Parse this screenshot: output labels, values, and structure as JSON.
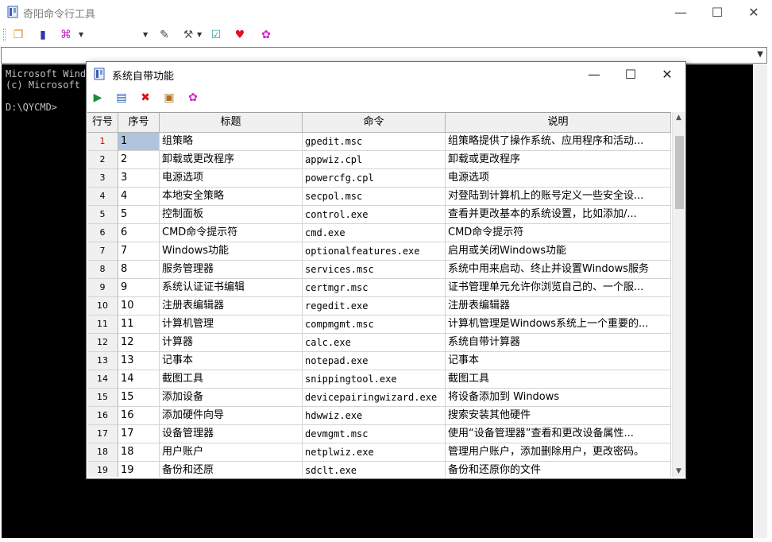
{
  "main_window": {
    "title": "奇阳命令行工具",
    "controls": {
      "minimize": "—",
      "maximize": "☐",
      "close": "✕"
    }
  },
  "console": {
    "lines": [
      "Microsoft Windo",
      "(c) Microsoft C",
      "",
      "D:\\QYCMD>"
    ]
  },
  "dialog": {
    "title": "系统自带功能",
    "controls": {
      "minimize": "—",
      "maximize": "☐",
      "close": "✕"
    },
    "toolbar": [
      {
        "name": "run-icon",
        "glyph": "▶",
        "color": "#1e8c3a"
      },
      {
        "name": "document-icon",
        "glyph": "▤",
        "color": "#1e5bb8"
      },
      {
        "name": "delete-icon",
        "glyph": "✖",
        "color": "#e01010"
      },
      {
        "name": "save-icon",
        "glyph": "▣",
        "color": "#b07020"
      },
      {
        "name": "settings-icon",
        "glyph": "✿",
        "color": "#d020d0"
      }
    ],
    "table": {
      "headers": [
        "行号",
        "序号",
        "标题",
        "命令",
        "说明"
      ],
      "rows": [
        [
          "1",
          "1",
          "组策略",
          "gpedit.msc",
          "组策略提供了操作系统、应用程序和活动..."
        ],
        [
          "2",
          "2",
          "卸载或更改程序",
          "appwiz.cpl",
          "卸载或更改程序"
        ],
        [
          "3",
          "3",
          "电源选项",
          "powercfg.cpl",
          "电源选项"
        ],
        [
          "4",
          "4",
          "本地安全策略",
          "secpol.msc",
          "对登陆到计算机上的账号定义一些安全设..."
        ],
        [
          "5",
          "5",
          "控制面板",
          "control.exe",
          "查看并更改基本的系统设置，比如添加/..."
        ],
        [
          "6",
          "6",
          "CMD命令提示符",
          "cmd.exe",
          "CMD命令提示符"
        ],
        [
          "7",
          "7",
          "Windows功能",
          "optionalfeatures.exe",
          "启用或关闭Windows功能"
        ],
        [
          "8",
          "8",
          "服务管理器",
          "services.msc",
          "系统中用来启动、终止并设置Windows服务"
        ],
        [
          "9",
          "9",
          "系统认证证书编辑",
          "certmgr.msc",
          "证书管理单元允许你浏览自己的、一个服..."
        ],
        [
          "10",
          "10",
          "注册表编辑器",
          "regedit.exe",
          "注册表编辑器"
        ],
        [
          "11",
          "11",
          "计算机管理",
          "compmgmt.msc",
          "计算机管理是Windows系统上一个重要的..."
        ],
        [
          "12",
          "12",
          "计算器",
          "calc.exe",
          "系统自带计算器"
        ],
        [
          "13",
          "13",
          "记事本",
          "notepad.exe",
          "记事本"
        ],
        [
          "14",
          "14",
          "截图工具",
          "snippingtool.exe",
          "截图工具"
        ],
        [
          "15",
          "15",
          "添加设备",
          "devicepairingwizard.exe",
          "将设备添加到 Windows"
        ],
        [
          "16",
          "16",
          "添加硬件向导",
          "hdwwiz.exe",
          "搜索安装其他硬件"
        ],
        [
          "17",
          "17",
          "设备管理器",
          "devmgmt.msc",
          "使用“设备管理器”查看和更改设备属性..."
        ],
        [
          "18",
          "18",
          "用户账户",
          "netplwiz.exe",
          "管理用户账户，添加删除用户，更改密码。"
        ],
        [
          "19",
          "19",
          "备份和还原",
          "sdclt.exe",
          "备份和还原你的文件"
        ]
      ]
    }
  },
  "main_toolbar": [
    {
      "name": "copy-icon",
      "glyph": "❐",
      "color": "#e08a1e"
    },
    {
      "name": "book-icon",
      "glyph": "▮",
      "color": "#2a3aa8"
    },
    {
      "name": "link-icon",
      "glyph": "⌘",
      "color": "#c020c0"
    },
    {
      "name": "brush-icon",
      "glyph": "✎",
      "color": "#444444"
    },
    {
      "name": "tools-icon",
      "glyph": "⚒",
      "color": "#555555"
    },
    {
      "name": "check-icon",
      "glyph": "☑",
      "color": "#3aa0a0"
    },
    {
      "name": "heart-icon",
      "glyph": "♥",
      "color": "#e01020"
    },
    {
      "name": "gear-icon",
      "glyph": "✿",
      "color": "#d020d0"
    }
  ]
}
